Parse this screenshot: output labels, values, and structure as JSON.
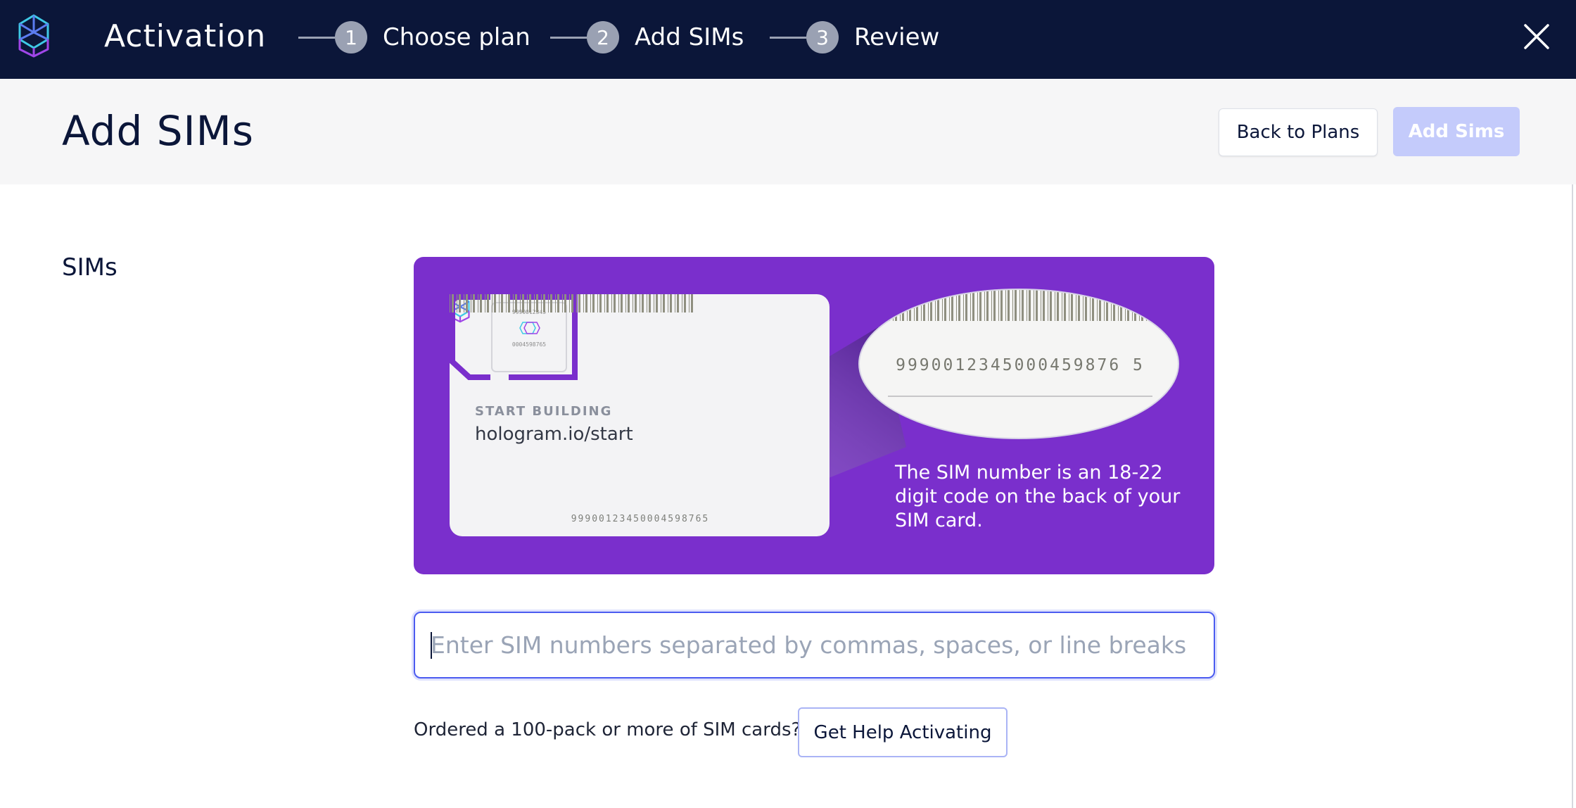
{
  "topbar": {
    "logo_icon": "hologram-logo-icon",
    "title": "Activation",
    "steps": [
      {
        "number": "1",
        "label": "Choose plan"
      },
      {
        "number": "2",
        "label": "Add SIMs"
      },
      {
        "number": "3",
        "label": "Review"
      }
    ],
    "close_icon": "close-icon",
    "background_color": "#0b1639"
  },
  "header": {
    "page_title": "Add SIMs",
    "back_button_label": "Back to Plans",
    "add_button_label": "Add Sims",
    "add_button_state": "disabled"
  },
  "main": {
    "section_label": "SIMs",
    "banner": {
      "background_color": "#7a2fcc",
      "card_tagline": "START BUILDING",
      "card_url": "hologram.io/start",
      "card_barcode_number": "99900123450004598765",
      "chip_line_1": "9990012345",
      "chip_line_2": "0004598765",
      "zoom_barcode_number": "9990012345000459876 5",
      "description": "The SIM number is an 18-22 digit code on the back of your SIM card."
    },
    "sim_input": {
      "value": "",
      "placeholder": "Enter SIM numbers separated by commas, spaces, or line breaks"
    },
    "bulk_prompt": "Ordered a 100-pack or more of SIM cards?",
    "help_button_label": "Get Help Activating"
  }
}
